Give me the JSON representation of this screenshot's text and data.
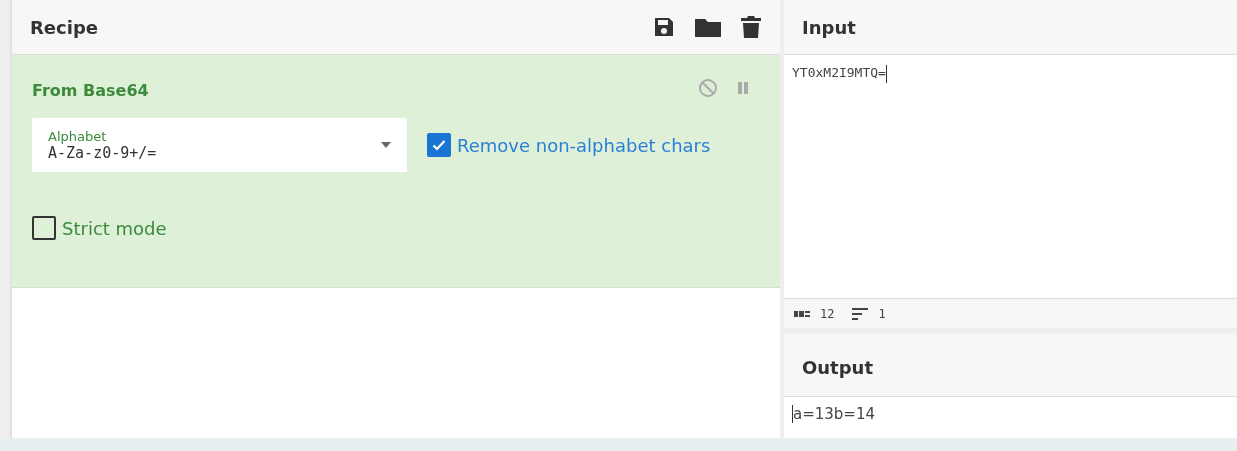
{
  "recipe": {
    "title": "Recipe",
    "operations": [
      {
        "name": "From Base64",
        "args": [
          {
            "kind": "dropdown",
            "label": "Alphabet",
            "value": "A-Za-z0-9+/="
          },
          {
            "kind": "checkbox",
            "label": "Remove non-alphabet chars",
            "checked": true
          },
          {
            "kind": "checkbox",
            "label": "Strict mode",
            "checked": false
          }
        ]
      }
    ]
  },
  "input": {
    "title": "Input",
    "value": "YT0xM2I9MTQ=",
    "length": "12",
    "lines": "1"
  },
  "output": {
    "title": "Output",
    "value": "a=13b=14"
  }
}
